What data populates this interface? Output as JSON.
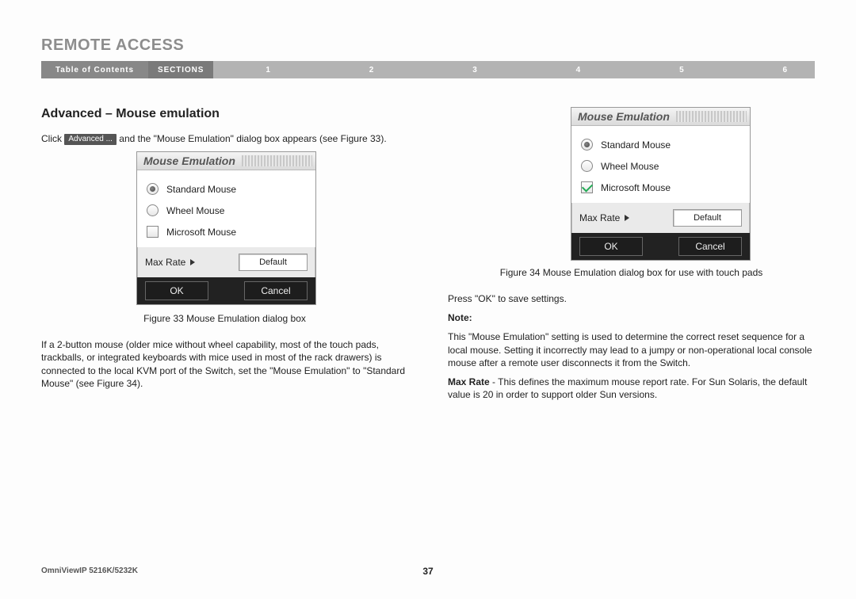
{
  "page_title": "REMOTE ACCESS",
  "nav": {
    "toc": "Table of Contents",
    "sections_label": "SECTIONS",
    "items": [
      "1",
      "2",
      "3",
      "4",
      "5",
      "6"
    ]
  },
  "subheading": "Advanced – Mouse emulation",
  "left": {
    "intro_pre": "Click",
    "advanced_btn": "Advanced ...",
    "intro_post": " and the \"Mouse Emulation\" dialog box appears (see Figure 33).",
    "caption33": "Figure 33 Mouse Emulation dialog box",
    "para2": "If a 2-button mouse (older mice without wheel capability, most of the touch pads, trackballs, or integrated keyboards with mice used in most of the rack drawers) is connected to the local KVM port of the Switch, set the \"Mouse Emulation\" to \"Standard Mouse\" (see Figure 34)."
  },
  "right": {
    "caption34": "Figure 34 Mouse Emulation dialog box for use with touch pads",
    "pressok": "Press \"OK\" to save settings.",
    "note_label": "Note:",
    "note_body": "This \"Mouse Emulation\" setting is used to determine the correct reset sequence for a local mouse. Setting it incorrectly may lead to a jumpy or non-operational local console mouse after a remote user disconnects it from the Switch.",
    "maxrate_label": "Max Rate",
    "maxrate_body": " - This defines the maximum mouse report rate. For Sun Solaris, the default value is 20 in order to support older Sun versions."
  },
  "dialog": {
    "title": "Mouse Emulation",
    "opts": {
      "standard": "Standard Mouse",
      "wheel": "Wheel Mouse",
      "microsoft": "Microsoft Mouse"
    },
    "maxrate": "Max Rate",
    "default": "Default",
    "ok": "OK",
    "cancel": "Cancel"
  },
  "footer": {
    "model": "OmniViewIP 5216K/5232K",
    "pagenum": "37"
  }
}
